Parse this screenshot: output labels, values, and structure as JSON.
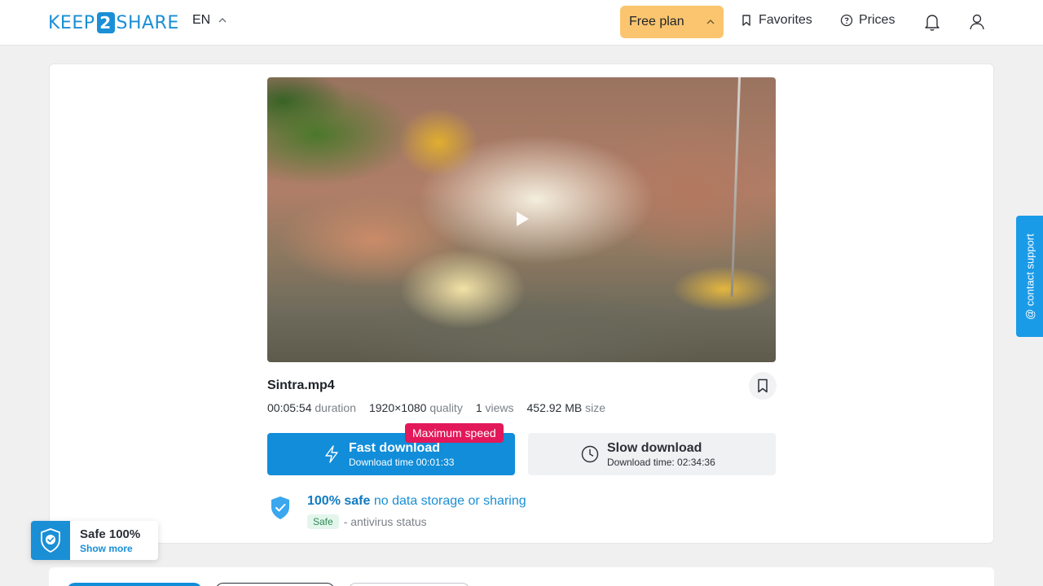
{
  "header": {
    "logo_text_left": "KEEP",
    "logo_text_mid": "2",
    "logo_text_right": "SHARE",
    "language": "EN",
    "plan_label": "Free plan",
    "favorites_label": "Favorites",
    "prices_label": "Prices"
  },
  "file": {
    "name": "Sintra.mp4",
    "duration_value": "00:05:54",
    "duration_label": "duration",
    "quality_value": "1920×1080",
    "quality_label": "quality",
    "views_value": "1",
    "views_label": "views",
    "size_value": "452.92 MB",
    "size_label": "size"
  },
  "download": {
    "badge": "Maximum speed",
    "fast_title": "Fast download",
    "fast_time": "Download time 00:01:33",
    "slow_title": "Slow download",
    "slow_time": "Download time: 02:34:36"
  },
  "safety": {
    "bold": "100% safe",
    "rest": " no data storage or sharing",
    "pill": "Safe",
    "status": "- antivirus status"
  },
  "widget": {
    "title": "Safe 100%",
    "link": "Show more"
  },
  "support": {
    "label": "@ contact support"
  },
  "colors": {
    "accent": "#118dd9",
    "plan": "#fbc56f",
    "badge": "#e2185a"
  },
  "icons": [
    "chevron-up-icon",
    "bookmark-icon",
    "help-circle-icon",
    "bell-icon",
    "user-icon",
    "play-icon",
    "lightning-icon",
    "clock-icon",
    "shield-check-icon"
  ]
}
